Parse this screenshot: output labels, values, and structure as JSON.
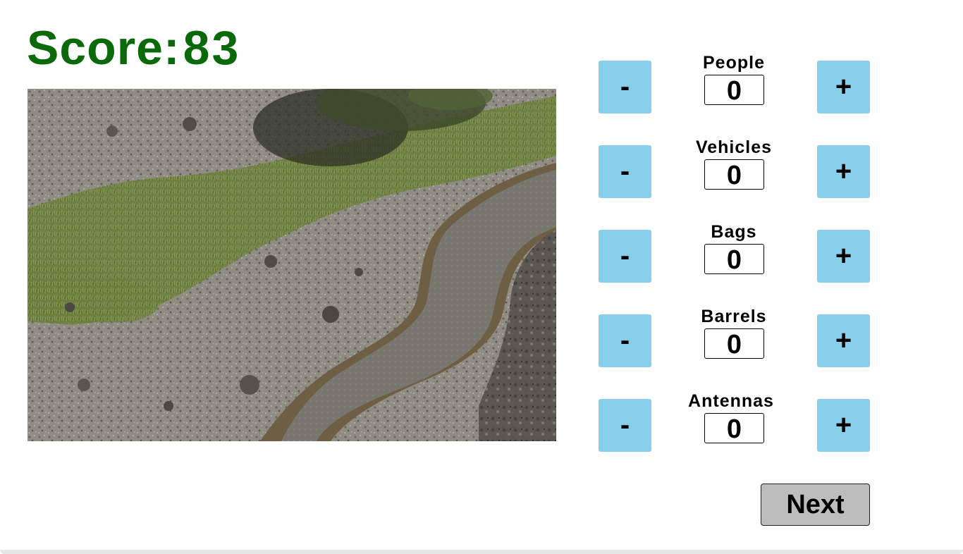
{
  "score": {
    "label": "Score:",
    "value": "83"
  },
  "scene": {
    "description_icon": "aerial-terrain-image"
  },
  "counters": [
    {
      "label": "People",
      "value": "0",
      "minus": "-",
      "plus": "+"
    },
    {
      "label": "Vehicles",
      "value": "0",
      "minus": "-",
      "plus": "+"
    },
    {
      "label": "Bags",
      "value": "0",
      "minus": "-",
      "plus": "+"
    },
    {
      "label": "Barrels",
      "value": "0",
      "minus": "-",
      "plus": "+"
    },
    {
      "label": "Antennas",
      "value": "0",
      "minus": "-",
      "plus": "+"
    }
  ],
  "next_label": "Next",
  "colors": {
    "score": "#0a6a0a",
    "counter_button": "#87ceeb",
    "next_button": "#bdbdbd"
  }
}
